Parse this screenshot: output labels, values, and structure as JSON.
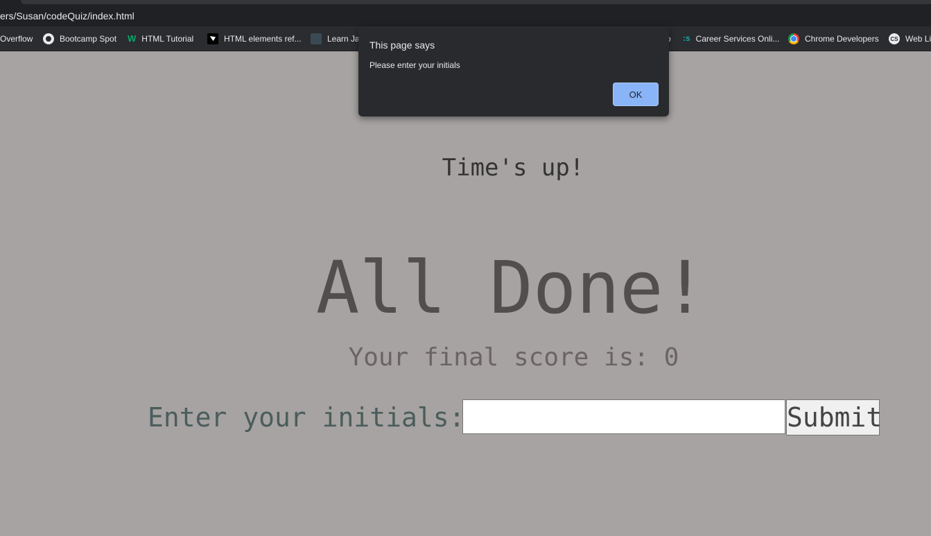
{
  "browser": {
    "url": "ers/Susan/codeQuiz/index.html",
    "bookmarks": [
      {
        "label": "Overflow",
        "icon": "none"
      },
      {
        "label": "Bootcamp Spot",
        "icon": "globe-icon"
      },
      {
        "label": "HTML Tutorial",
        "icon": "w3schools-icon"
      },
      {
        "label": "HTML elements ref...",
        "icon": "mdn-icon"
      },
      {
        "label": "Learn Jav",
        "icon": "learn-icon"
      },
      {
        "label": "o",
        "icon": "none"
      },
      {
        "label": "Career Services Onli...",
        "icon": "career-services-icon"
      },
      {
        "label": "Chrome Developers",
        "icon": "chrome-icon"
      },
      {
        "label": "Web Li",
        "icon": "cs-icon"
      }
    ]
  },
  "dialog": {
    "title": "This page says",
    "message": "Please enter your initials",
    "ok_label": "OK"
  },
  "quiz": {
    "times_up": "Time's up!",
    "heading": "All Done!",
    "final_score": "Your final score is: 0",
    "initials_label": "Enter your initials:",
    "initials_value": "",
    "submit_label": "Submit"
  }
}
